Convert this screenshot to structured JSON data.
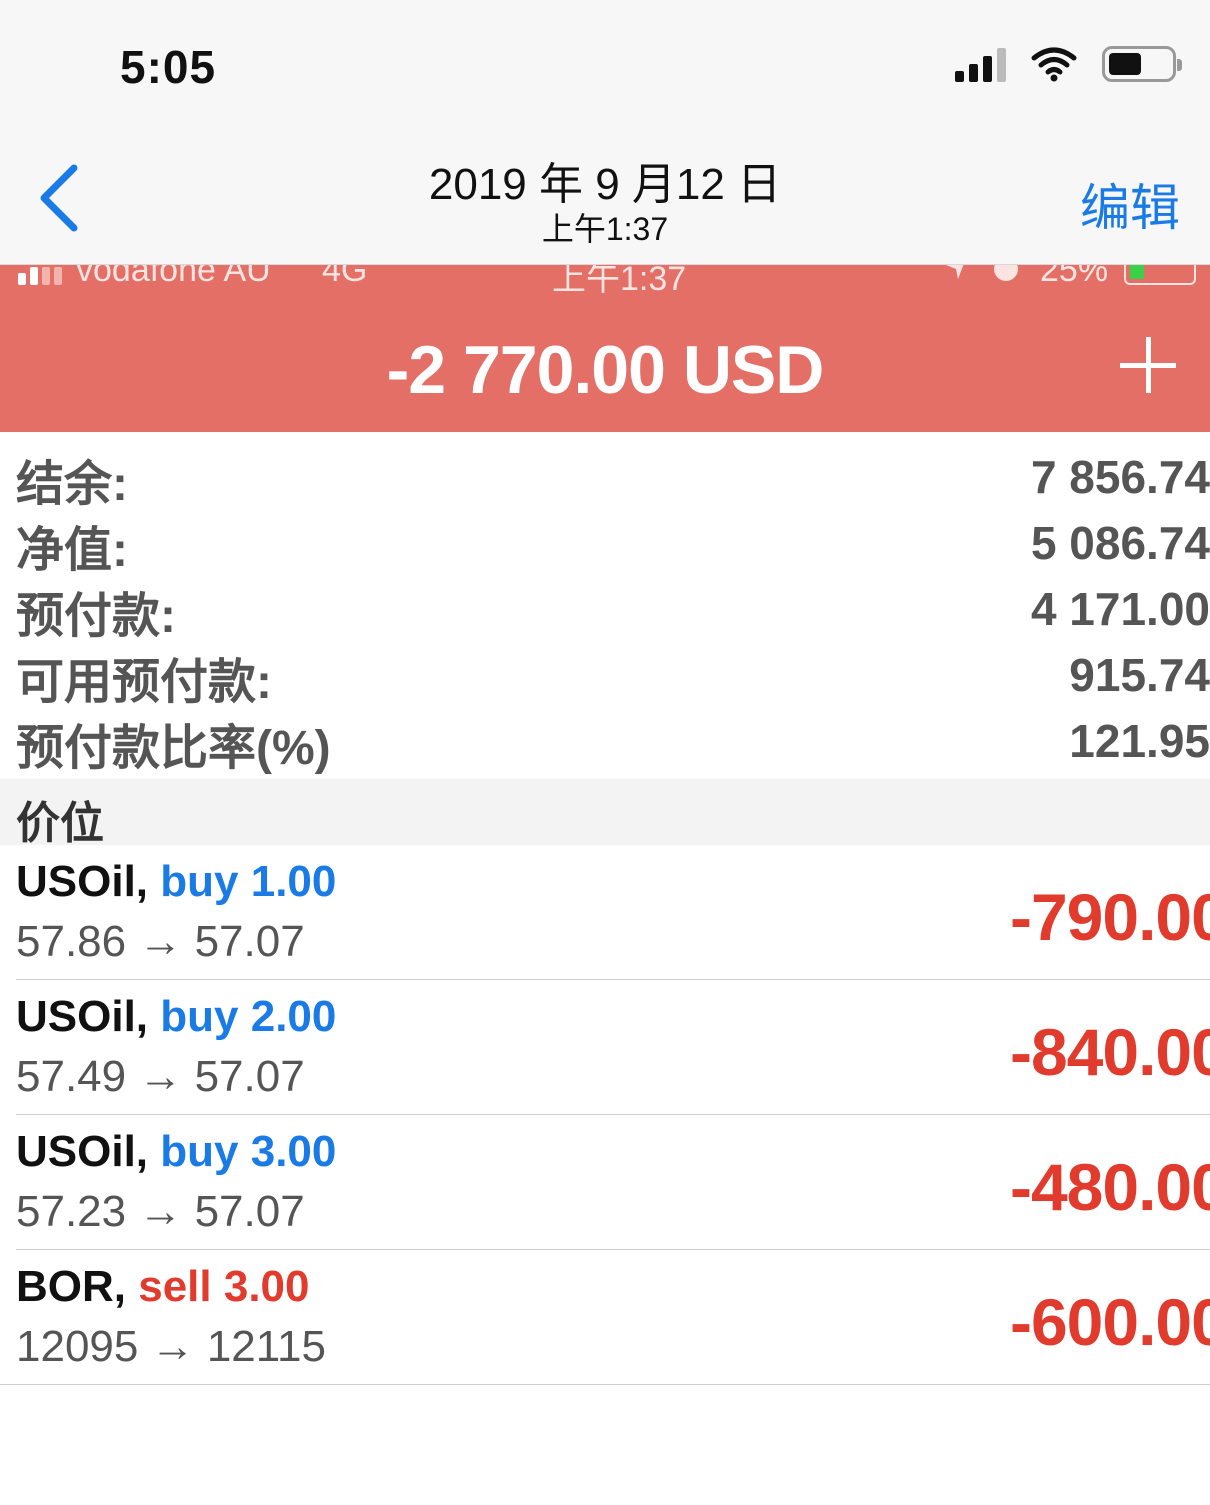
{
  "status_bar": {
    "time": "5:05"
  },
  "nav": {
    "title": "2019 年 9 月12 日",
    "subtitle": "上午1:37",
    "edit_label": "编辑"
  },
  "inner_status": {
    "carrier": "vodafone AU",
    "network": "4G",
    "time": "上午1:37",
    "battery": "25%"
  },
  "profit": {
    "value": "-2 770.00 USD",
    "background_color": "#e46f66"
  },
  "summary": [
    {
      "label": "结余:",
      "value": "7 856.74"
    },
    {
      "label": "净值:",
      "value": "5 086.74"
    },
    {
      "label": "预付款:",
      "value": "4 171.00"
    },
    {
      "label": "可用预付款:",
      "value": "915.74"
    },
    {
      "label": "预付款比率(%)",
      "value": "121.95"
    }
  ],
  "section": {
    "title": "价位"
  },
  "positions": [
    {
      "symbol": "USOil,",
      "side": "buy",
      "volume": "1.00",
      "open": "57.86",
      "arrow": "→",
      "current": "57.07",
      "profit": "-790.00"
    },
    {
      "symbol": "USOil,",
      "side": "buy",
      "volume": "2.00",
      "open": "57.49",
      "arrow": "→",
      "current": "57.07",
      "profit": "-840.00"
    },
    {
      "symbol": "USOil,",
      "side": "buy",
      "volume": "3.00",
      "open": "57.23",
      "arrow": "→",
      "current": "57.07",
      "profit": "-480.00"
    },
    {
      "symbol": "BOR,",
      "side": "sell",
      "volume": "3.00",
      "open": "12095",
      "arrow": "→",
      "current": "12115",
      "profit": "-600.00"
    }
  ],
  "colors": {
    "accent_blue": "#1a7be6",
    "loss_red": "#e03b2c"
  }
}
